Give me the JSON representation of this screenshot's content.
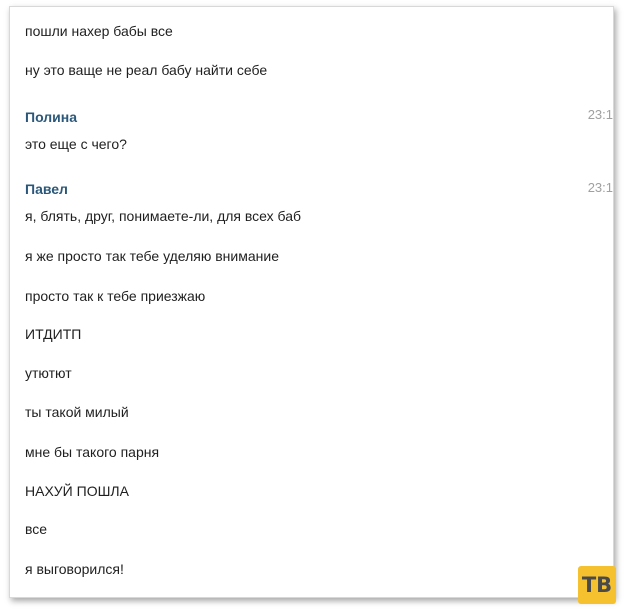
{
  "messages_top": [
    "пошли нахер бабы все",
    "ну это ваще не реал бабу найти себе"
  ],
  "polina": {
    "author": "Полина",
    "time": "23:1",
    "text": "это еще с чего?"
  },
  "pavel": {
    "author": "Павел",
    "time": "23:1",
    "lines": [
      "я, блять, друг, понимаете-ли, для всех баб",
      "я же просто так тебе уделяю внимание",
      "просто так к тебе приезжаю",
      "ИТДИТП",
      "утютют",
      "ты такой милый",
      "мне бы такого парня",
      "НАХУЙ ПОШЛА",
      "все",
      "я выговорился!"
    ]
  },
  "watermark": "ТВ",
  "colors": {
    "author": "#2b587a",
    "time": "#a0a0a0",
    "logo_bg": "#f5c12e"
  }
}
